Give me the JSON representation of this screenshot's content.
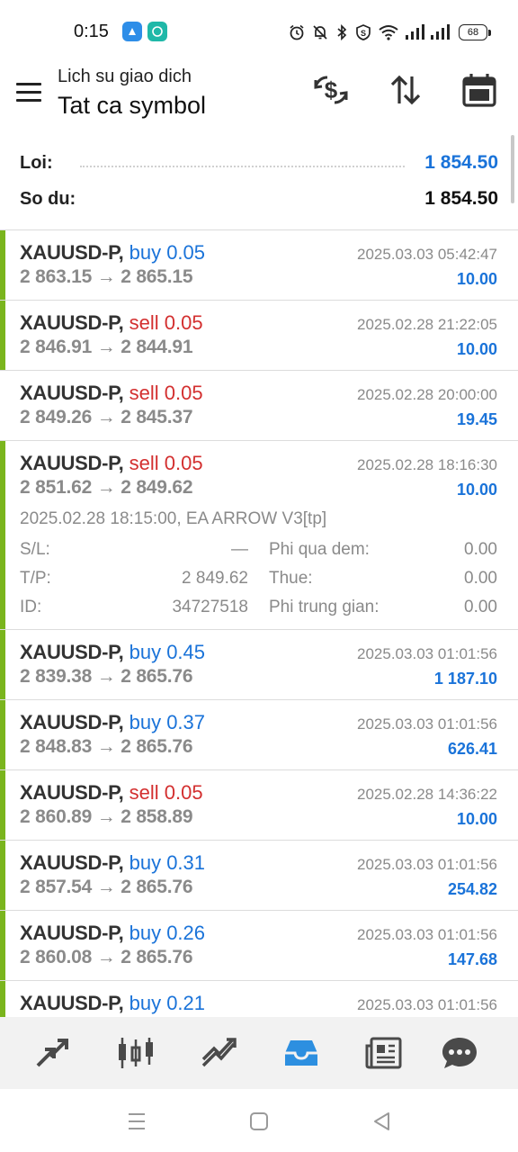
{
  "status_bar": {
    "time": "0:15",
    "battery": "68",
    "icons": [
      "alarm-icon",
      "bell-off-icon",
      "bluetooth-icon",
      "shield-icon",
      "wifi-icon",
      "signal-icon",
      "signal-icon"
    ]
  },
  "header": {
    "subtitle": "Lich su giao dich",
    "title": "Tat ca symbol",
    "actions": [
      "currency-exchange-icon",
      "sort-icon",
      "calendar-icon"
    ]
  },
  "summary": {
    "profit_label": "Loi:",
    "profit_value": "1 854.50",
    "balance_label": "So du:",
    "balance_value": "1 854.50"
  },
  "trades": [
    {
      "symbol": "XAUUSD-P,",
      "type": "buy 0.05",
      "side": "buy",
      "prices": "2 863.15 → 2 865.15",
      "time": "2025.03.03 05:42:47",
      "profit": "10.00",
      "bar": true
    },
    {
      "symbol": "XAUUSD-P,",
      "type": "sell 0.05",
      "side": "sell",
      "prices": "2 846.91 → 2 844.91",
      "time": "2025.02.28 21:22:05",
      "profit": "10.00",
      "bar": true
    },
    {
      "symbol": "XAUUSD-P,",
      "type": "sell 0.05",
      "side": "sell",
      "prices": "2 849.26 → 2 845.37",
      "time": "2025.02.28 20:00:00",
      "profit": "19.45",
      "bar": false
    },
    {
      "symbol": "XAUUSD-P,",
      "type": "sell 0.05",
      "side": "sell",
      "prices": "2 851.62 → 2 849.62",
      "time": "2025.02.28 18:16:30",
      "profit": "10.00",
      "bar": true,
      "details": {
        "comment": "2025.02.28 18:15:00, EA ARROW V3[tp]",
        "sl_label": "S/L:",
        "sl_value": "—",
        "tp_label": "T/P:",
        "tp_value": "2 849.62",
        "id_label": "ID:",
        "id_value": "34727518",
        "swap_label": "Phi qua dem:",
        "swap_value": "0.00",
        "tax_label": "Thue:",
        "tax_value": "0.00",
        "commission_label": "Phi trung gian:",
        "commission_value": "0.00"
      }
    },
    {
      "symbol": "XAUUSD-P,",
      "type": "buy 0.45",
      "side": "buy",
      "prices": "2 839.38 → 2 865.76",
      "time": "2025.03.03 01:01:56",
      "profit": "1 187.10",
      "bar": true
    },
    {
      "symbol": "XAUUSD-P,",
      "type": "buy 0.37",
      "side": "buy",
      "prices": "2 848.83 → 2 865.76",
      "time": "2025.03.03 01:01:56",
      "profit": "626.41",
      "bar": true
    },
    {
      "symbol": "XAUUSD-P,",
      "type": "sell 0.05",
      "side": "sell",
      "prices": "2 860.89 → 2 858.89",
      "time": "2025.02.28 14:36:22",
      "profit": "10.00",
      "bar": true
    },
    {
      "symbol": "XAUUSD-P,",
      "type": "buy 0.31",
      "side": "buy",
      "prices": "2 857.54 → 2 865.76",
      "time": "2025.03.03 01:01:56",
      "profit": "254.82",
      "bar": true
    },
    {
      "symbol": "XAUUSD-P,",
      "type": "buy 0.26",
      "side": "buy",
      "prices": "2 860.08 → 2 865.76",
      "time": "2025.03.03 01:01:56",
      "profit": "147.68",
      "bar": true
    },
    {
      "symbol": "XAUUSD-P,",
      "type": "buy 0.21",
      "side": "buy",
      "prices": "",
      "time": "2025.03.03 01:01:56",
      "profit": "",
      "bar": true
    }
  ],
  "bottom_nav": [
    {
      "icon": "quotes-icon",
      "active": false
    },
    {
      "icon": "chart-icon",
      "active": false
    },
    {
      "icon": "trade-icon",
      "active": false
    },
    {
      "icon": "history-icon",
      "active": true
    },
    {
      "icon": "news-icon",
      "active": false
    },
    {
      "icon": "chat-icon",
      "active": false
    }
  ],
  "colors": {
    "buy": "#1a73d9",
    "sell": "#d32f2f",
    "profit": "#1a73d9",
    "bar": "#7ab51d",
    "active_nav": "#2d8fe0",
    "inactive_nav": "#4a4a4a"
  }
}
